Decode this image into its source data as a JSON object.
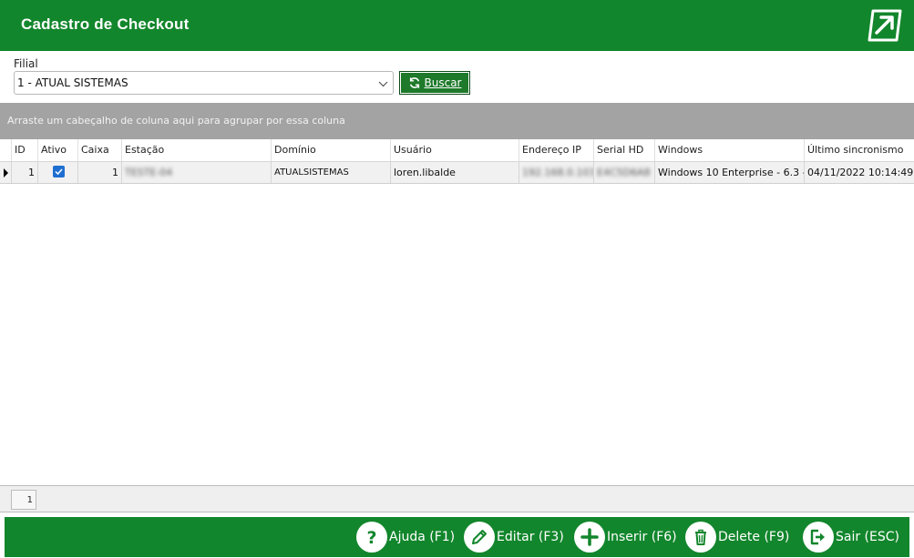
{
  "header": {
    "title": "Cadastro de Checkout",
    "logo_icon": "exit-arrow-logo-icon"
  },
  "filter": {
    "label": "Filial",
    "selected": "1 - ATUAL SISTEMAS",
    "search_button": "Buscar"
  },
  "group_panel": {
    "hint": "Arraste um cabeçalho de coluna aqui para agrupar por essa coluna"
  },
  "grid": {
    "columns": [
      "ID",
      "Ativo",
      "Caixa",
      "Estação",
      "Domínio",
      "Usuário",
      "Endereço IP",
      "Serial HD",
      "Windows",
      "Último sincronismo"
    ],
    "rows": [
      {
        "id": "1",
        "ativo": true,
        "caixa": "1",
        "estacao": "TESTE-04",
        "dominio": "ATUALSISTEMAS",
        "usuario": "loren.libalde",
        "ip": "192.168.0.103",
        "serial_hd": "E4C5D6A8",
        "windows": "Windows 10 Enterprise - 6.3 -",
        "ultimo_sincronismo": "04/11/2022 10:14:49"
      }
    ]
  },
  "pager": {
    "page": "1"
  },
  "toolbar": {
    "ajuda": "Ajuda (F1)",
    "editar": "Editar (F3)",
    "inserir": "Inserir (F6)",
    "delete": "Delete (F9)",
    "sair": "Sair (ESC)"
  },
  "colors": {
    "brand_green": "#12862c",
    "button_green": "#1e7a2a",
    "group_gray": "#a3a3a3",
    "check_blue": "#1e6fd1"
  }
}
